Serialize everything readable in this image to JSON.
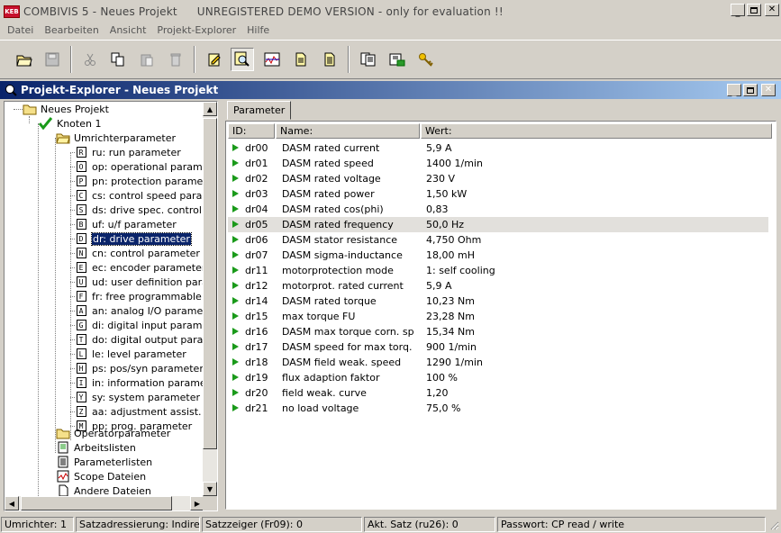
{
  "window": {
    "logo_text": "KEB",
    "title": "COMBIVIS 5 - Neues Projekt",
    "demo_notice": "UNREGISTERED DEMO VERSION - only for evaluation !!"
  },
  "menu": [
    "Datei",
    "Bearbeiten",
    "Ansicht",
    "Projekt-Explorer",
    "Hilfe"
  ],
  "explorer": {
    "title": "Projekt-Explorer - Neues Projekt",
    "tree": {
      "root": "Neues Projekt",
      "node": "Knoten 1",
      "group": "Umrichterparameter",
      "params": [
        {
          "letter": "R",
          "label": "ru: run parameter"
        },
        {
          "letter": "O",
          "label": "op: operational parameter"
        },
        {
          "letter": "P",
          "label": "pn: protection parameter"
        },
        {
          "letter": "C",
          "label": "cs: control speed paramet"
        },
        {
          "letter": "S",
          "label": "ds: drive spec. control par"
        },
        {
          "letter": "B",
          "label": "uf: u/f parameter"
        },
        {
          "letter": "D",
          "label": "dr: drive parameter"
        },
        {
          "letter": "N",
          "label": "cn: control parameter"
        },
        {
          "letter": "E",
          "label": "ec: encoder parameter"
        },
        {
          "letter": "U",
          "label": "ud: user definition para."
        },
        {
          "letter": "F",
          "label": "fr: free programmable para"
        },
        {
          "letter": "A",
          "label": "an: analog I/O parameter"
        },
        {
          "letter": "G",
          "label": "di: digital input parameter"
        },
        {
          "letter": "T",
          "label": "do: digital output paramete"
        },
        {
          "letter": "L",
          "label": "le: level parameter"
        },
        {
          "letter": "H",
          "label": "ps: pos/syn parameter"
        },
        {
          "letter": "I",
          "label": "in: information parameter"
        },
        {
          "letter": "Y",
          "label": "sy: system parameter"
        },
        {
          "letter": "Z",
          "label": "aa: adjustment assist. para"
        },
        {
          "letter": "M",
          "label": "pp: prog. parameter"
        }
      ],
      "others": [
        "Operatorparameter",
        "Arbeitslisten",
        "Parameterlisten",
        "Scope Dateien",
        "Andere Dateien"
      ]
    }
  },
  "param_panel": {
    "tab": "Parameter",
    "columns": {
      "id": "ID:",
      "name": "Name:",
      "value": "Wert:"
    },
    "rows": [
      {
        "id": "dr00",
        "name": "DASM rated current",
        "value": "5,9 A"
      },
      {
        "id": "dr01",
        "name": "DASM rated speed",
        "value": "1400 1/min"
      },
      {
        "id": "dr02",
        "name": "DASM rated voltage",
        "value": "230 V"
      },
      {
        "id": "dr03",
        "name": "DASM rated power",
        "value": "1,50 kW"
      },
      {
        "id": "dr04",
        "name": "DASM rated cos(phi)",
        "value": "0,83"
      },
      {
        "id": "dr05",
        "name": "DASM rated frequency",
        "value": "50,0 Hz"
      },
      {
        "id": "dr06",
        "name": "DASM stator resistance",
        "value": "4,750 Ohm"
      },
      {
        "id": "dr07",
        "name": "DASM sigma-inductance",
        "value": "18,00 mH"
      },
      {
        "id": "dr11",
        "name": "motorprotection mode",
        "value": "1: self cooling"
      },
      {
        "id": "dr12",
        "name": "motorprot. rated current",
        "value": "5,9 A"
      },
      {
        "id": "dr14",
        "name": "DASM rated torque",
        "value": "10,23 Nm"
      },
      {
        "id": "dr15",
        "name": "max torque FU",
        "value": "23,28 Nm"
      },
      {
        "id": "dr16",
        "name": "DASM max torque corn. sp",
        "value": "15,34 Nm"
      },
      {
        "id": "dr17",
        "name": "DASM speed for max torq.",
        "value": "900 1/min"
      },
      {
        "id": "dr18",
        "name": "DASM field weak. speed",
        "value": "1290 1/min"
      },
      {
        "id": "dr19",
        "name": "flux adaption faktor",
        "value": "100 %"
      },
      {
        "id": "dr20",
        "name": "field weak. curve",
        "value": "1,20"
      },
      {
        "id": "dr21",
        "name": "no load voltage",
        "value": "75,0 %"
      }
    ]
  },
  "status": {
    "umrichter": "Umrichter: 1",
    "satzadressierung": "Satzadressierung: Indirekt",
    "satzzeiger": "Satzzeiger (Fr09):  0",
    "akt_satz": "Akt. Satz (ru26): 0",
    "passwort": "Passwort: CP read / write"
  },
  "colors": {
    "title_bar": "#0a246a",
    "run_arrow": "#1a9a1a",
    "selection": "#0a246a"
  }
}
